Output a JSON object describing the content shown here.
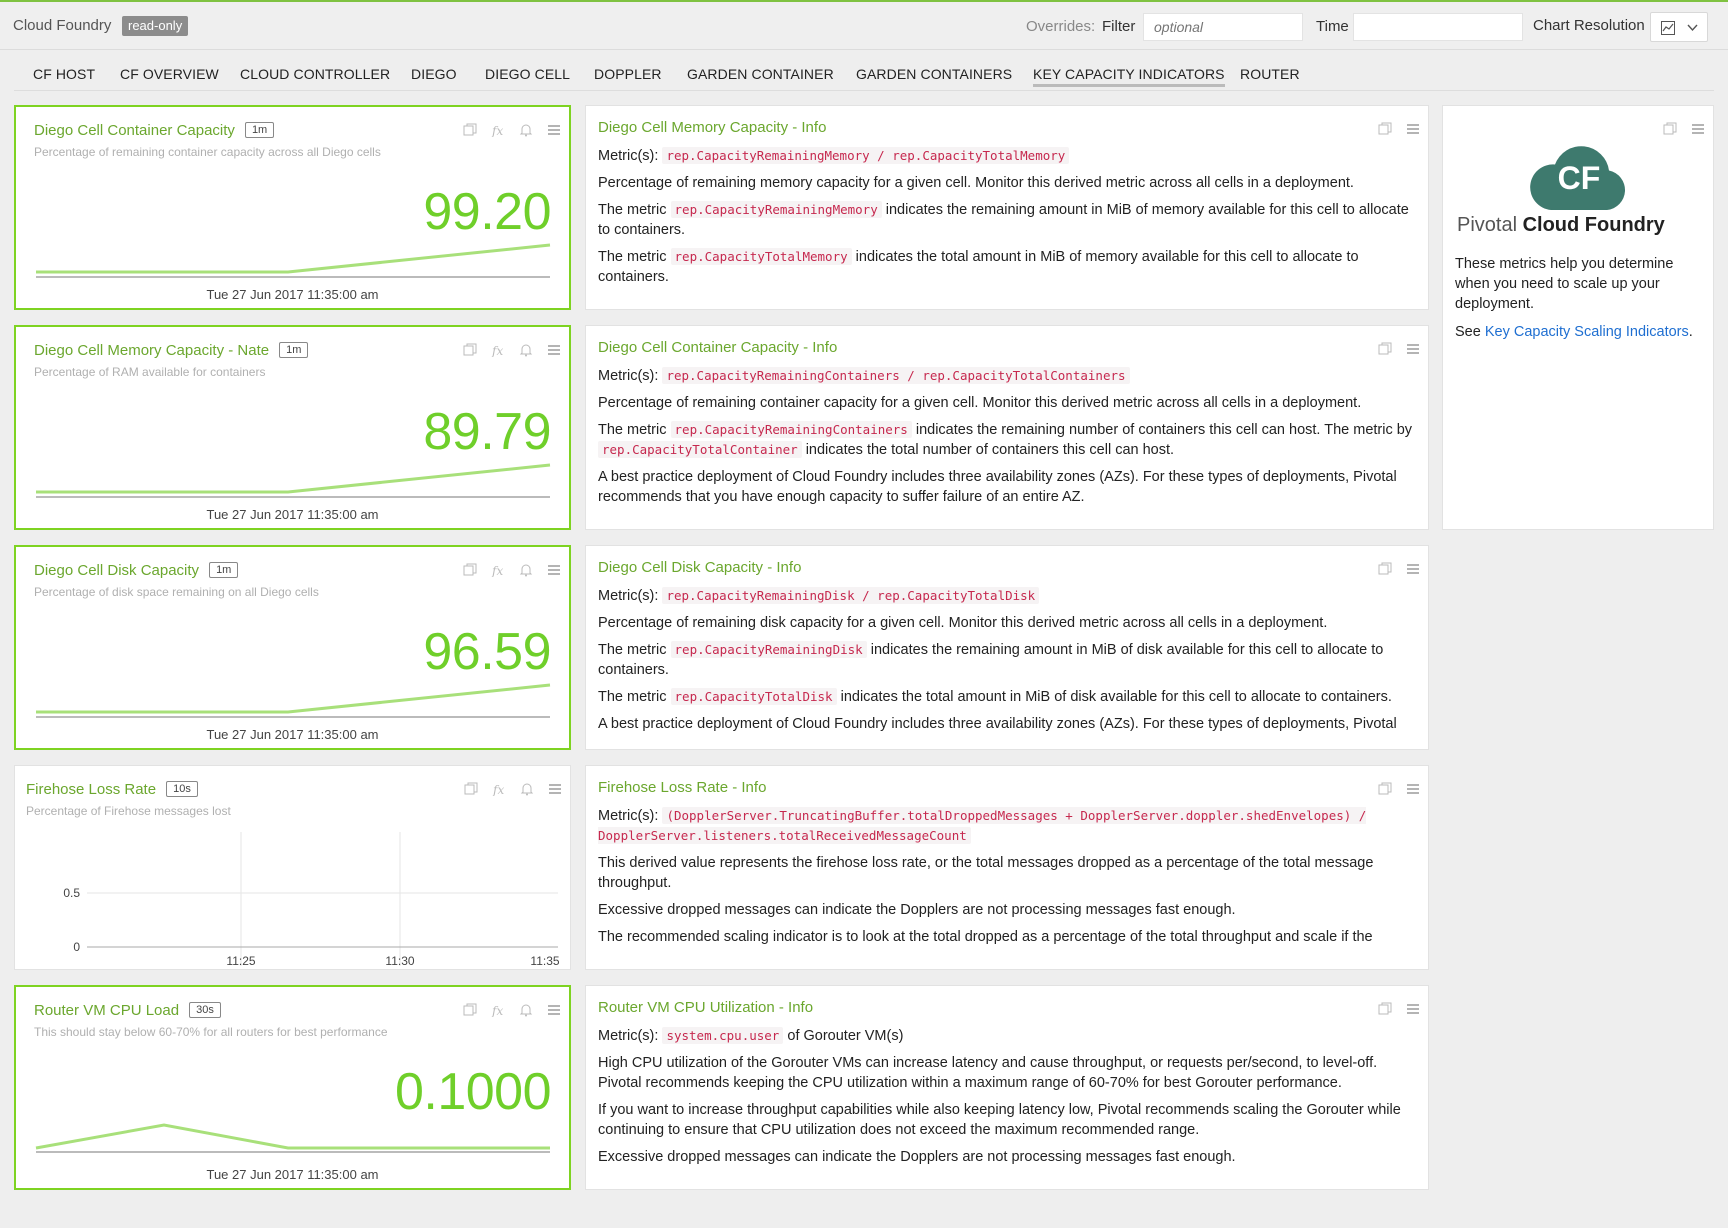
{
  "header": {
    "app_title": "Cloud Foundry",
    "readonly_badge": "read-only",
    "overrides_label": "Overrides:",
    "filter_label": "Filter",
    "filter_placeholder": "optional",
    "time_label": "Time",
    "time_value": "",
    "chart_resolution_label": "Chart Resolution",
    "chart_resolution_icon": "line-chart-icon"
  },
  "tabs": [
    {
      "label": "CF HOST"
    },
    {
      "label": "CF OVERVIEW"
    },
    {
      "label": "CLOUD CONTROLLER"
    },
    {
      "label": "DIEGO"
    },
    {
      "label": "DIEGO CELL"
    },
    {
      "label": "DOPPLER"
    },
    {
      "label": "GARDEN CONTAINER"
    },
    {
      "label": "GARDEN CONTAINERS"
    },
    {
      "label": "KEY CAPACITY INDICATORS",
      "active": true
    },
    {
      "label": "ROUTER"
    }
  ],
  "metric_panels": [
    {
      "title": "Diego Cell Container Capacity",
      "interval": "1m",
      "subtitle": "Percentage of remaining container capacity across all Diego cells",
      "value": "99.20",
      "timestamp": "Tue 27 Jun 2017 11:35:00 am",
      "highlighted": true
    },
    {
      "title": "Diego Cell Memory Capacity - Nate",
      "interval": "1m",
      "subtitle": "Percentage of RAM available for containers",
      "value": "89.79",
      "timestamp": "Tue 27 Jun 2017 11:35:00 am",
      "highlighted": true
    },
    {
      "title": "Diego Cell Disk Capacity",
      "interval": "1m",
      "subtitle": "Percentage of disk space remaining on all Diego cells",
      "value": "96.59",
      "timestamp": "Tue 27 Jun 2017 11:35:00 am",
      "highlighted": true
    },
    {
      "title": "Firehose Loss Rate",
      "interval": "10s",
      "subtitle": "Percentage of Firehose messages lost",
      "highlighted": false,
      "chart": {
        "y_ticks": [
          "0.5",
          "0"
        ],
        "x_ticks": [
          "11:25",
          "11:30",
          "11:35"
        ]
      }
    },
    {
      "title": "Router VM CPU Load",
      "interval": "30s",
      "subtitle": "This should stay below 60-70% for all routers for best performance",
      "value": "0.1000",
      "timestamp": "Tue 27 Jun 2017 11:35:00 am",
      "highlighted": true
    }
  ],
  "info_panels": [
    {
      "title": "Diego Cell Memory Capacity - Info",
      "metrics_label": "Metric(s):",
      "metric_code": "rep.CapacityRemainingMemory / rep.CapacityTotalMemory",
      "p1": "Percentage of remaining memory capacity for a given cell. Monitor this derived metric across all cells in a deployment.",
      "p2_pre": "The metric",
      "p2_code": "rep.CapacityRemainingMemory",
      "p2_post": "indicates the remaining amount in MiB of memory available for this cell to allocate to containers.",
      "p3_pre": "The metric",
      "p3_code": "rep.CapacityTotalMemory",
      "p3_post": "indicates the total amount in MiB of memory available for this cell to allocate to containers."
    },
    {
      "title": "Diego Cell Container Capacity - Info",
      "metrics_label": "Metric(s):",
      "metric_code": "rep.CapacityRemainingContainers / rep.CapacityTotalContainers",
      "p1": "Percentage of remaining container capacity for a given cell. Monitor this derived metric across all cells in a deployment.",
      "p2_pre": "The metric",
      "p2_code": "rep.CapacityRemainingContainers",
      "p2_mid": "indicates the remaining number of containers this cell can host. The metric by",
      "p2_code2": "rep.CapacityTotalContainer",
      "p2_post": "indicates the total number of containers this cell can host.",
      "p3": "A best practice deployment of Cloud Foundry includes three availability zones (AZs). For these types of deployments, Pivotal recommends that you have enough capacity to suffer failure of an entire AZ."
    },
    {
      "title": "Diego Cell Disk Capacity - Info",
      "metrics_label": "Metric(s):",
      "metric_code": "rep.CapacityRemainingDisk / rep.CapacityTotalDisk",
      "p1": "Percentage of remaining disk capacity for a given cell. Monitor this derived metric across all cells in a deployment.",
      "p2_pre": "The metric",
      "p2_code": "rep.CapacityRemainingDisk",
      "p2_post": "indicates the remaining amount in MiB of disk available for this cell to allocate to containers.",
      "p3_pre": "The metric",
      "p3_code": "rep.CapacityTotalDisk",
      "p3_post": "indicates the total amount in MiB of disk available for this cell to allocate to containers.",
      "p4": "A best practice deployment of Cloud Foundry includes three availability zones (AZs). For these types of deployments, Pivotal"
    },
    {
      "title": "Firehose Loss Rate - Info",
      "metrics_label": "Metric(s):",
      "metric_code": "(DopplerServer.TruncatingBuffer.totalDroppedMessages + DopplerServer.doppler.shedEnvelopes) / DopplerServer.listeners.totalReceivedMessageCount",
      "p1": "This derived value represents the firehose loss rate, or the total messages dropped as a percentage of the total message throughput.",
      "p2": "Excessive dropped messages can indicate the Dopplers are not processing messages fast enough.",
      "p3": "The recommended scaling indicator is to look at the total dropped as a percentage of the total throughput and scale if the"
    },
    {
      "title": "Router VM CPU Utilization - Info",
      "metrics_label": "Metric(s):",
      "metric_code": "system.cpu.user",
      "metric_suffix": "of Gorouter VM(s)",
      "p1": "High CPU utilization of the Gorouter VMs can increase latency and cause throughput, or requests per/second, to level-off. Pivotal recommends keeping the CPU utilization within a maximum range of 60-70% for best Gorouter performance.",
      "p2": "If you want to increase throughput capabilities while also keeping latency low, Pivotal recommends scaling the Gorouter while continuing to ensure that CPU utilization does not exceed the maximum recommended range.",
      "p3": "Excessive dropped messages can indicate the Dopplers are not processing messages fast enough."
    }
  ],
  "logo_panel": {
    "cf_mark": "CF",
    "brand_light": "Pivotal",
    "brand_bold": "Cloud Foundry",
    "description": "These metrics help you determine when you need to scale up your deployment.",
    "link_prefix": "See",
    "link_text": "Key Capacity Scaling Indicators",
    "link_suffix": "."
  },
  "colors": {
    "accent_green": "#7ed321",
    "title_green": "#6ba72e",
    "value_green": "#6fcf2a",
    "logo_teal": "#3e7a6e",
    "link_blue": "#1f6fd1",
    "code_red": "#c6284e"
  }
}
